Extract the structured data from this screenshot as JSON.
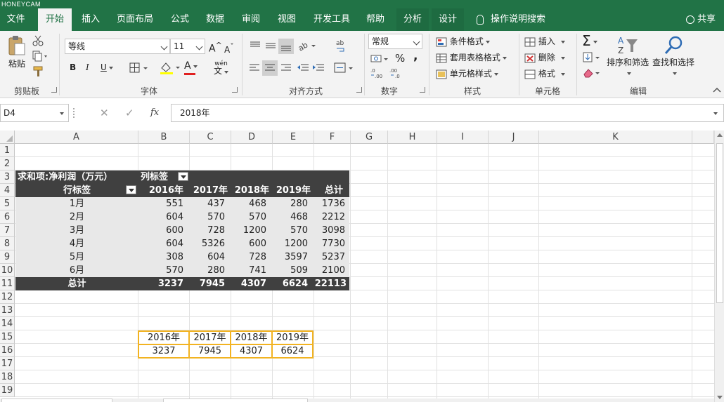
{
  "watermark": "HONEYCAM",
  "ribbon_tabs": [
    {
      "label": "文件"
    },
    {
      "label": "开始"
    },
    {
      "label": "插入"
    },
    {
      "label": "页面布局"
    },
    {
      "label": "公式"
    },
    {
      "label": "数据"
    },
    {
      "label": "审阅"
    },
    {
      "label": "视图"
    },
    {
      "label": "开发工具"
    },
    {
      "label": "帮助"
    },
    {
      "label": "分析"
    },
    {
      "label": "设计"
    }
  ],
  "tell_me": "操作说明搜索",
  "share": "共享",
  "clipboard": {
    "paste": "粘贴",
    "label": "剪贴板"
  },
  "font": {
    "name": "等线",
    "size": "11",
    "grow": "A",
    "shrink": "A",
    "bold": "B",
    "italic": "I",
    "underline": "U",
    "font_color": "A",
    "phonetic": "wén",
    "label": "字体"
  },
  "alignment": {
    "label": "对齐方式"
  },
  "number": {
    "format": "常规",
    "percent": "%",
    "comma": ",",
    "label": "数字"
  },
  "styles": {
    "conditional": "条件格式",
    "table": "套用表格格式",
    "cell_styles": "单元格样式",
    "label": "样式"
  },
  "cells": {
    "insert": "插入",
    "delete": "删除",
    "format": "格式",
    "label": "单元格"
  },
  "editing": {
    "sort": "排序和筛选",
    "find": "查找和选择",
    "label": "编辑"
  },
  "formula_bar": {
    "name_box": "D4",
    "cancel": "✕",
    "enter": "✓",
    "fx": "fx",
    "content": "2018年"
  },
  "columns": [
    "A",
    "B",
    "C",
    "D",
    "E",
    "F",
    "G",
    "H",
    "I",
    "J",
    "K"
  ],
  "rows": [
    "1",
    "2",
    "3",
    "4",
    "5",
    "6",
    "7",
    "8",
    "9",
    "10",
    "11",
    "12",
    "13",
    "14",
    "15",
    "16",
    "17",
    "18",
    "19"
  ],
  "pivot": {
    "title": "求和项:净利润（万元）",
    "col_label": "列标签",
    "row_label": "行标签",
    "headers": [
      "2016年",
      "2017年",
      "2018年",
      "2019年",
      "总计"
    ],
    "rows": [
      {
        "month": "1月",
        "values": [
          "551",
          "437",
          "468",
          "280",
          "1736"
        ]
      },
      {
        "month": "2月",
        "values": [
          "604",
          "570",
          "570",
          "468",
          "2212"
        ]
      },
      {
        "month": "3月",
        "values": [
          "600",
          "728",
          "1200",
          "570",
          "3098"
        ]
      },
      {
        "month": "4月",
        "values": [
          "604",
          "5326",
          "600",
          "1200",
          "7730"
        ]
      },
      {
        "month": "5月",
        "values": [
          "308",
          "604",
          "728",
          "3597",
          "5237"
        ]
      },
      {
        "month": "6月",
        "values": [
          "570",
          "280",
          "741",
          "509",
          "2100"
        ]
      }
    ],
    "total_label": "总计",
    "totals": [
      "3237",
      "7945",
      "4307",
      "6624",
      "22113"
    ]
  },
  "summary": {
    "years": [
      "2016年",
      "2017年",
      "2018年",
      "2019年"
    ],
    "values": [
      "3237",
      "7945",
      "4307",
      "6624"
    ]
  },
  "colors": {
    "excel_green": "#217346",
    "pivot_dark": "#404040",
    "pivot_light": "#e8e8e8",
    "highlight_border": "#f2b321"
  }
}
